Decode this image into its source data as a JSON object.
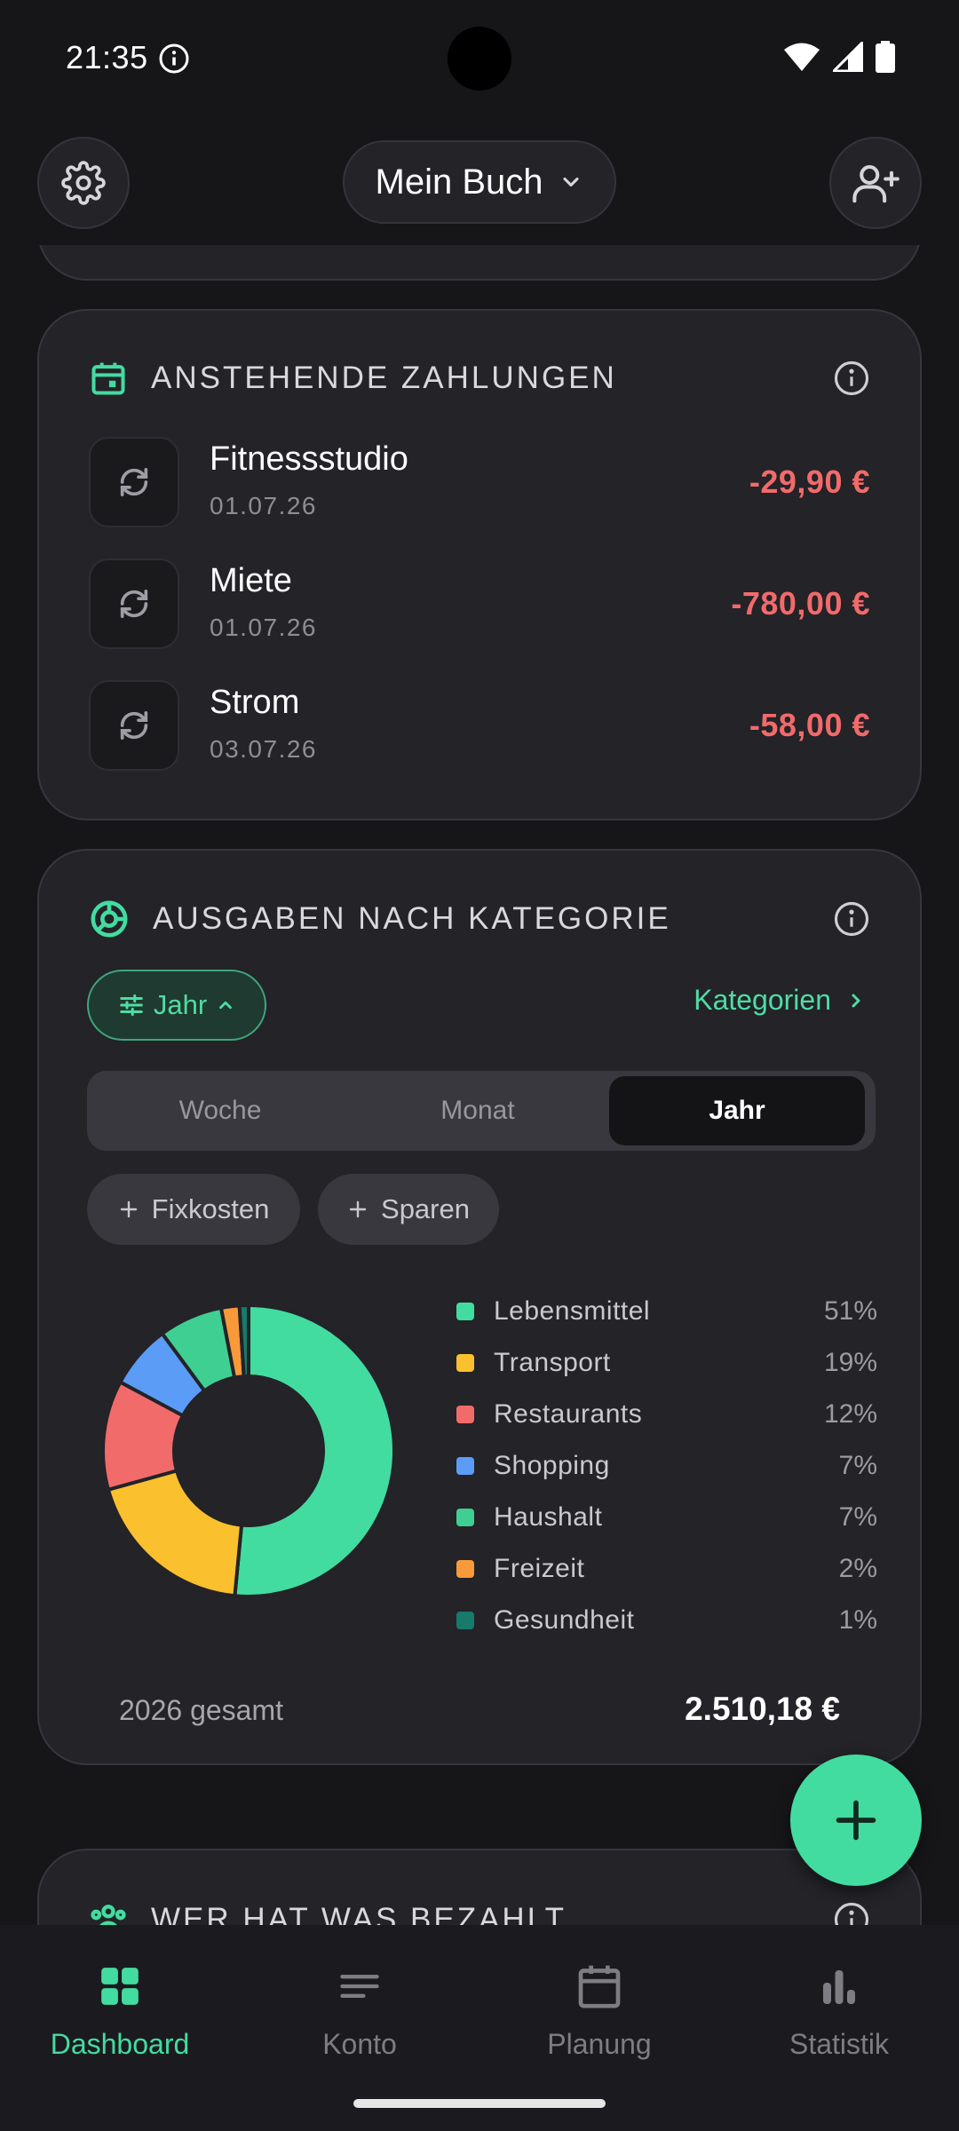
{
  "status_bar": {
    "time": "21:35"
  },
  "header": {
    "book_title": "Mein Buch"
  },
  "upcoming": {
    "title": "ANSTEHENDE ZAHLUNGEN",
    "items": [
      {
        "name": "Fitnessstudio",
        "date": "01.07.26",
        "amount": "-29,90 €"
      },
      {
        "name": "Miete",
        "date": "01.07.26",
        "amount": "-780,00 €"
      },
      {
        "name": "Strom",
        "date": "03.07.26",
        "amount": "-58,00 €"
      }
    ]
  },
  "categories": {
    "title": "AUSGABEN NACH KATEGORIE",
    "filter_label": "Jahr",
    "link_label": "Kategorien",
    "segments": [
      "Woche",
      "Monat",
      "Jahr"
    ],
    "selected_segment": "Jahr",
    "add_chips": [
      "Fixkosten",
      "Sparen"
    ],
    "total_label": "2026 gesamt",
    "total_value": "2.510,18 €"
  },
  "chart_data": {
    "type": "pie",
    "categories": [
      "Lebensmittel",
      "Transport",
      "Restaurants",
      "Shopping",
      "Haushalt",
      "Freizeit",
      "Gesundheit"
    ],
    "values": [
      51,
      19,
      12,
      7,
      7,
      2,
      1
    ],
    "labels": [
      "51%",
      "19%",
      "12%",
      "7%",
      "7%",
      "2%",
      "1%"
    ],
    "colors": [
      "#43dca0",
      "#fbc02d",
      "#f26b6b",
      "#5b9cf6",
      "#3fcf92",
      "#f89a3a",
      "#177a6a"
    ],
    "legend_position": "right"
  },
  "who_paid": {
    "title": "WER HAT WAS BEZAHLT"
  },
  "bottom_nav": {
    "items": [
      "Dashboard",
      "Konto",
      "Planung",
      "Statistik"
    ],
    "active": "Dashboard"
  },
  "colors": {
    "accent": "#43dca0",
    "negative": "#f26a6a",
    "background": "#161619",
    "card": "#232328"
  },
  "icons": {
    "settings": "gear-icon",
    "invite": "user-plus-icon",
    "dropdown": "chevron-down-icon",
    "upcoming": "calendar-icon",
    "recurring": "repeat-icon",
    "categories": "pie-chart-icon",
    "info": "info-icon",
    "fab": "plus-icon"
  }
}
